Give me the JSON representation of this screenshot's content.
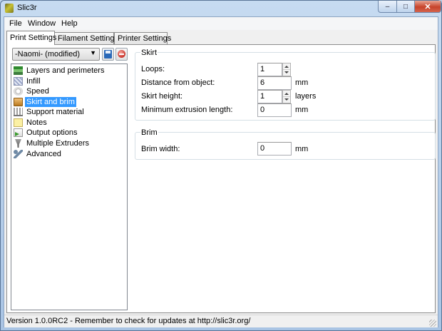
{
  "window": {
    "title": "Slic3r"
  },
  "menu": [
    "File",
    "Window",
    "Help"
  ],
  "tabs": [
    "Print Settings",
    "Filament Settings",
    "Printer Settings"
  ],
  "preset": {
    "value": "-Naomi- (modified)"
  },
  "tree": [
    {
      "label": "Layers and perimeters",
      "icon": "layers-icon"
    },
    {
      "label": "Infill",
      "icon": "infill-icon"
    },
    {
      "label": "Speed",
      "icon": "speed-icon"
    },
    {
      "label": "Skirt and brim",
      "icon": "skirt-icon",
      "selected": true
    },
    {
      "label": "Support material",
      "icon": "support-icon"
    },
    {
      "label": "Notes",
      "icon": "notes-icon"
    },
    {
      "label": "Output options",
      "icon": "output-icon"
    },
    {
      "label": "Multiple Extruders",
      "icon": "extruder-icon"
    },
    {
      "label": "Advanced",
      "icon": "wrench-icon"
    }
  ],
  "skirt": {
    "title": "Skirt",
    "loops": {
      "label": "Loops:",
      "value": "1"
    },
    "distance": {
      "label": "Distance from object:",
      "value": "6",
      "unit": "mm"
    },
    "height": {
      "label": "Skirt height:",
      "value": "1",
      "unit": "layers"
    },
    "min_extrusion": {
      "label": "Minimum extrusion length:",
      "value": "0",
      "unit": "mm"
    }
  },
  "brim": {
    "title": "Brim",
    "width": {
      "label": "Brim width:",
      "value": "0",
      "unit": "mm"
    }
  },
  "status": "Version 1.0.0RC2 - Remember to check for updates at http://slic3r.org/",
  "colors": {
    "selection": "#3399ff",
    "close_button": "#c7432b"
  }
}
